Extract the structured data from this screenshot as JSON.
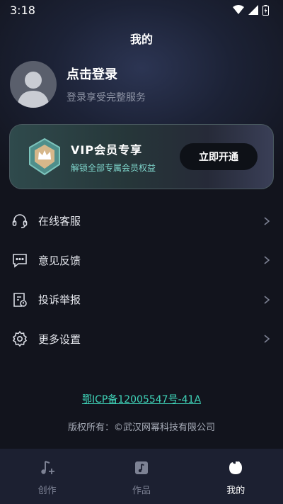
{
  "status_bar": {
    "time": "3:18"
  },
  "header": {
    "title": "我的"
  },
  "profile": {
    "title": "点击登录",
    "subtitle": "登录享受完整服务"
  },
  "vip": {
    "title": "VIP会员专享",
    "subtitle": "解锁全部专属会员权益",
    "button_label": "立即开通"
  },
  "menu": [
    {
      "label": "在线客服",
      "icon": "headset-icon"
    },
    {
      "label": "意见反馈",
      "icon": "chat-bubble-icon"
    },
    {
      "label": "投诉举报",
      "icon": "report-document-icon"
    },
    {
      "label": "更多设置",
      "icon": "gear-icon"
    }
  ],
  "footer": {
    "icp": "鄂ICP备12005547号-41A",
    "copyright": "版权所有：©武汉网幂科技有限公司"
  },
  "bottom_nav": [
    {
      "label": "创作",
      "icon": "music-note-icon",
      "active": false
    },
    {
      "label": "作品",
      "icon": "music-album-icon",
      "active": false
    },
    {
      "label": "我的",
      "icon": "profile-blob-icon",
      "active": true
    }
  ],
  "colors": {
    "accent": "#3fd3b8",
    "background": "#12141d",
    "nav_background": "#1c2031"
  }
}
